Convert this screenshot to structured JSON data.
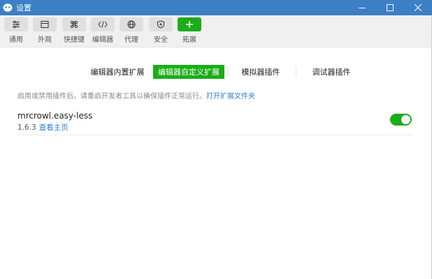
{
  "window": {
    "title": "设置",
    "accent_color": "#3c7fc5",
    "controls": [
      "minimize-icon",
      "maximize-icon",
      "close-icon"
    ]
  },
  "toolbar": {
    "items": [
      {
        "label": "通用",
        "icon": "sliders-icon"
      },
      {
        "label": "外观",
        "icon": "window-icon"
      },
      {
        "label": "快捷键",
        "icon": "command-key-icon"
      },
      {
        "label": "编辑器",
        "icon": "code-icon"
      },
      {
        "label": "代理",
        "icon": "globe-icon"
      },
      {
        "label": "安全",
        "icon": "shield-icon"
      },
      {
        "label": "拓展",
        "icon": "plus-icon",
        "active": true
      }
    ],
    "active_color": "#1aad19"
  },
  "tabs": [
    {
      "label": "编辑器内置扩展",
      "active": false
    },
    {
      "label": "编辑器自定义扩展",
      "active": true
    },
    {
      "label": "模拟器插件",
      "active": false
    },
    {
      "label": "调试器插件",
      "active": false
    }
  ],
  "info": {
    "text": "启用或禁用插件后，请重启开发者工具以确保插件正常运行。",
    "link": "打开扩展文件夹"
  },
  "plugins": [
    {
      "name": "mrcrowl.easy-less",
      "version": "1.6.3",
      "homepage_link": "查看主页",
      "enabled": true
    }
  ]
}
